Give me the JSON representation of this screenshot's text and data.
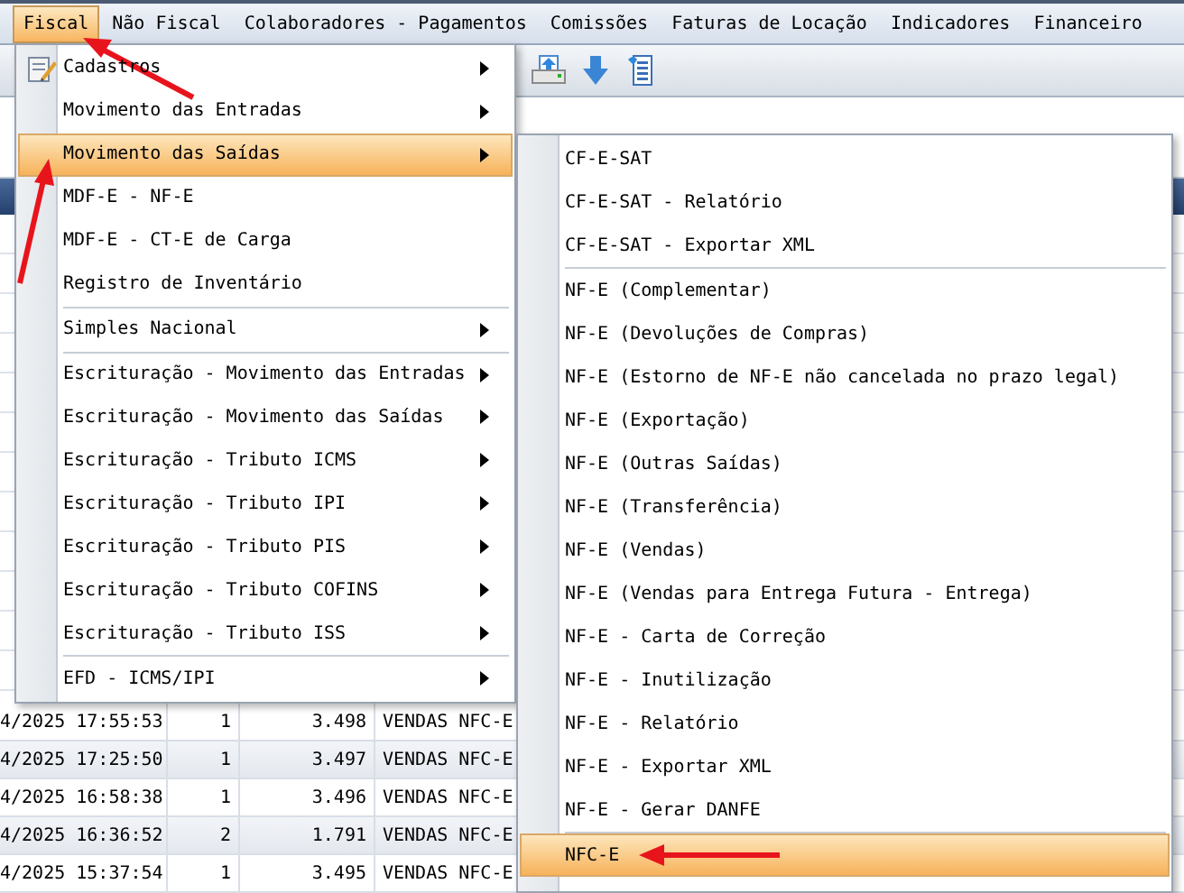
{
  "menu_bar": [
    {
      "label": "Fiscal",
      "selected": true
    },
    {
      "label": "Não Fiscal",
      "selected": false
    },
    {
      "label": "Colaboradores - Pagamentos",
      "selected": false
    },
    {
      "label": "Comissões",
      "selected": false
    },
    {
      "label": "Faturas de Locação",
      "selected": false
    },
    {
      "label": "Indicadores",
      "selected": false
    },
    {
      "label": "Financeiro",
      "selected": false
    }
  ],
  "table": {
    "rows": [
      [
        "4/2025 17:55:53",
        "1",
        "3.498",
        "VENDAS NFC-E"
      ],
      [
        "4/2025 17:25:50",
        "1",
        "3.497",
        "VENDAS NFC-E"
      ],
      [
        "4/2025 16:58:38",
        "1",
        "3.496",
        "VENDAS NFC-E"
      ],
      [
        "4/2025 16:36:52",
        "2",
        "1.791",
        "VENDAS NFC-E"
      ],
      [
        "4/2025 15:37:54",
        "1",
        "3.495",
        "VENDAS NFC-E"
      ]
    ]
  },
  "fiscal_menu": {
    "items": [
      {
        "kind": "item",
        "label": "Cadastros",
        "has_icon": true,
        "has_submenu": true,
        "selected": false
      },
      {
        "kind": "item",
        "label": "Movimento das Entradas",
        "has_icon": false,
        "has_submenu": true,
        "selected": false
      },
      {
        "kind": "item",
        "label": "Movimento das Saídas",
        "has_icon": false,
        "has_submenu": true,
        "selected": true
      },
      {
        "kind": "item",
        "label": "MDF-E - NF-E",
        "has_icon": false,
        "has_submenu": false,
        "selected": false
      },
      {
        "kind": "item",
        "label": "MDF-E - CT-E de Carga",
        "has_icon": false,
        "has_submenu": false,
        "selected": false
      },
      {
        "kind": "item",
        "label": "Registro de Inventário",
        "has_icon": false,
        "has_submenu": false,
        "selected": false
      },
      {
        "kind": "separator"
      },
      {
        "kind": "item",
        "label": "Simples Nacional",
        "has_icon": false,
        "has_submenu": true,
        "selected": false
      },
      {
        "kind": "separator"
      },
      {
        "kind": "item",
        "label": "Escrituração - Movimento das Entradas",
        "has_icon": false,
        "has_submenu": true,
        "selected": false
      },
      {
        "kind": "item",
        "label": "Escrituração - Movimento das Saídas",
        "has_icon": false,
        "has_submenu": true,
        "selected": false
      },
      {
        "kind": "item",
        "label": "Escrituração - Tributo ICMS",
        "has_icon": false,
        "has_submenu": true,
        "selected": false
      },
      {
        "kind": "item",
        "label": "Escrituração - Tributo IPI",
        "has_icon": false,
        "has_submenu": true,
        "selected": false
      },
      {
        "kind": "item",
        "label": "Escrituração - Tributo PIS",
        "has_icon": false,
        "has_submenu": true,
        "selected": false
      },
      {
        "kind": "item",
        "label": "Escrituração - Tributo COFINS",
        "has_icon": false,
        "has_submenu": true,
        "selected": false
      },
      {
        "kind": "item",
        "label": "Escrituração - Tributo ISS",
        "has_icon": false,
        "has_submenu": true,
        "selected": false
      },
      {
        "kind": "separator"
      },
      {
        "kind": "item",
        "label": "EFD - ICMS/IPI",
        "has_icon": false,
        "has_submenu": true,
        "selected": false
      }
    ]
  },
  "saidas_submenu": {
    "items": [
      {
        "kind": "item",
        "label": "CF-E-SAT",
        "selected": false
      },
      {
        "kind": "item",
        "label": "CF-E-SAT - Relatório",
        "selected": false
      },
      {
        "kind": "item",
        "label": "CF-E-SAT - Exportar XML",
        "selected": false
      },
      {
        "kind": "separator"
      },
      {
        "kind": "item",
        "label": "NF-E (Complementar)",
        "selected": false
      },
      {
        "kind": "item",
        "label": "NF-E (Devoluções de Compras)",
        "selected": false
      },
      {
        "kind": "item",
        "label": "NF-E (Estorno de NF-E não cancelada no prazo legal)",
        "selected": false
      },
      {
        "kind": "item",
        "label": "NF-E (Exportação)",
        "selected": false
      },
      {
        "kind": "item",
        "label": "NF-E (Outras Saídas)",
        "selected": false
      },
      {
        "kind": "item",
        "label": "NF-E (Transferência)",
        "selected": false
      },
      {
        "kind": "item",
        "label": "NF-E (Vendas)",
        "selected": false
      },
      {
        "kind": "item",
        "label": "NF-E (Vendas para Entrega Futura - Entrega)",
        "selected": false
      },
      {
        "kind": "item",
        "label": "NF-E - Carta de Correção",
        "selected": false
      },
      {
        "kind": "item",
        "label": "NF-E - Inutilização",
        "selected": false
      },
      {
        "kind": "item",
        "label": "NF-E - Relatório",
        "selected": false
      },
      {
        "kind": "item",
        "label": "NF-E - Exportar XML",
        "selected": false
      },
      {
        "kind": "item",
        "label": "NF-E - Gerar DANFE",
        "selected": false
      },
      {
        "kind": "separator"
      },
      {
        "kind": "item",
        "label": "NFC-E",
        "selected": true
      }
    ]
  }
}
